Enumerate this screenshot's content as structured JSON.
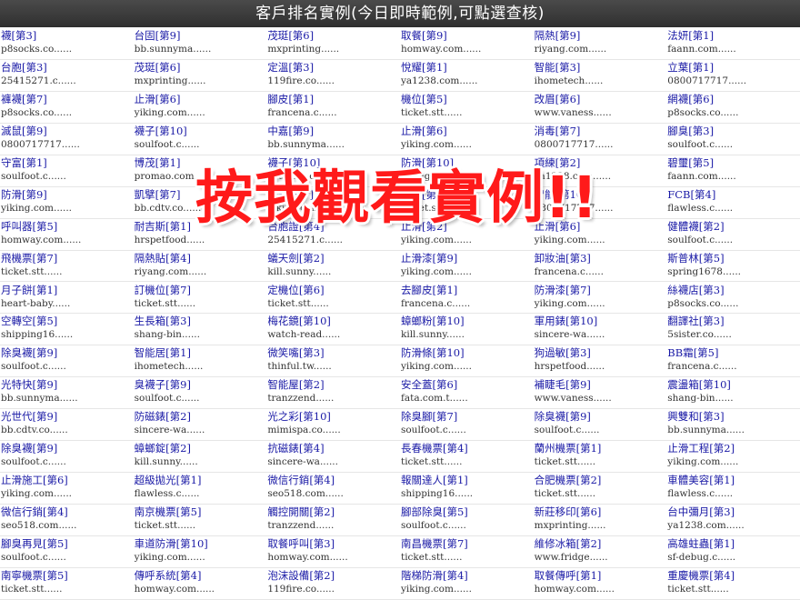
{
  "header": {
    "title": "客戶排名實例(今日即時範例,可點選查核)"
  },
  "overlay": {
    "text": "按我觀看實例!!"
  },
  "rows": [
    [
      {
        "kw": "襪",
        "rank": "[第3]",
        "site": "p8socks.co......"
      },
      {
        "kw": "台固",
        "rank": "[第9]",
        "site": "bb.sunnyma......"
      },
      {
        "kw": "茂珽",
        "rank": "[第6]",
        "site": "mxprinting......"
      },
      {
        "kw": "取餐",
        "rank": "[第9]",
        "site": "homway.com......"
      },
      {
        "kw": "隔熱",
        "rank": "[第9]",
        "site": "riyang.com......"
      },
      {
        "kw": "法妍",
        "rank": "[第1]",
        "site": "faann.com......"
      }
    ],
    [
      {
        "kw": "台胞",
        "rank": "[第3]",
        "site": "25415271.c......"
      },
      {
        "kw": "茂珽",
        "rank": "[第6]",
        "site": "mxprinting......"
      },
      {
        "kw": "定溫",
        "rank": "[第3]",
        "site": "119fire.co......"
      },
      {
        "kw": "悅耀",
        "rank": "[第1]",
        "site": "ya1238.com......"
      },
      {
        "kw": "智能",
        "rank": "[第3]",
        "site": "ihometech......"
      },
      {
        "kw": "立葉",
        "rank": "[第1]",
        "site": "0800717717......"
      }
    ],
    [
      {
        "kw": "褲襪",
        "rank": "[第7]",
        "site": "p8socks.co......"
      },
      {
        "kw": "止滑",
        "rank": "[第6]",
        "site": "yiking.com......"
      },
      {
        "kw": "腳皮",
        "rank": "[第1]",
        "site": "francena.c......"
      },
      {
        "kw": "機位",
        "rank": "[第5]",
        "site": "ticket.stt......"
      },
      {
        "kw": "改眉",
        "rank": "[第6]",
        "site": "www.vaness......"
      },
      {
        "kw": "網襪",
        "rank": "[第6]",
        "site": "p8socks.co......"
      }
    ],
    [
      {
        "kw": "滅鼠",
        "rank": "[第9]",
        "site": "0800717717......"
      },
      {
        "kw": "襪子",
        "rank": "[第10]",
        "site": "soulfoot.c......"
      },
      {
        "kw": "中嘉",
        "rank": "[第9]",
        "site": "bb.sunnyma......"
      },
      {
        "kw": "止滑",
        "rank": "[第6]",
        "site": "yiking.com......"
      },
      {
        "kw": "消毒",
        "rank": "[第7]",
        "site": "0800717717......"
      },
      {
        "kw": "腳臭",
        "rank": "[第3]",
        "site": "soulfoot.c......"
      }
    ],
    [
      {
        "kw": "守富",
        "rank": "[第1]",
        "site": "soulfoot.c......"
      },
      {
        "kw": "博茂",
        "rank": "[第1]",
        "site": "promao.com......"
      },
      {
        "kw": "襪子",
        "rank": "[第10]",
        "site": "soulfoot.c......"
      },
      {
        "kw": "防滑",
        "rank": "[第10]",
        "site": "yiking.com......"
      },
      {
        "kw": "項練",
        "rank": "[第2]",
        "site": "ya1238.com......"
      },
      {
        "kw": "碧璽",
        "rank": "[第5]",
        "site": "faann.com......"
      }
    ],
    [
      {
        "kw": "防滑",
        "rank": "[第9]",
        "site": "yiking.com......"
      },
      {
        "kw": "凱擘",
        "rank": "[第7]",
        "site": "bb.cdtv.co......"
      },
      {
        "kw": "防滑",
        "rank": "[第7]",
        "site": "yiking.com......"
      },
      {
        "kw": "機位",
        "rank": "[第8]",
        "site": "ticket.stt......"
      },
      {
        "kw": "智能",
        "rank": "[第10]",
        "site": "0800717717......"
      },
      {
        "kw": "FCB",
        "rank": "[第4]",
        "site": "flawless.c......"
      }
    ],
    [
      {
        "kw": "呼叫器",
        "rank": "[第5]",
        "site": "homway.com......"
      },
      {
        "kw": "耐吉斯",
        "rank": "[第1]",
        "site": "hrspetfood......"
      },
      {
        "kw": "台胞證",
        "rank": "[第4]",
        "site": "25415271.c......"
      },
      {
        "kw": "止滑",
        "rank": "[第2]",
        "site": "yiking.com......"
      },
      {
        "kw": "止滑",
        "rank": "[第6]",
        "site": "yiking.com......"
      },
      {
        "kw": "健體襪",
        "rank": "[第2]",
        "site": "soulfoot.c......"
      }
    ],
    [
      {
        "kw": "飛機票",
        "rank": "[第7]",
        "site": "ticket.stt......"
      },
      {
        "kw": "隔熱貼",
        "rank": "[第4]",
        "site": "riyang.com......"
      },
      {
        "kw": "蟻天劍",
        "rank": "[第2]",
        "site": "kill.sunny......"
      },
      {
        "kw": "止滑漆",
        "rank": "[第9]",
        "site": "yiking.com......"
      },
      {
        "kw": "卸妝油",
        "rank": "[第3]",
        "site": "francena.c......"
      },
      {
        "kw": "斯普林",
        "rank": "[第5]",
        "site": "spring1678......"
      }
    ],
    [
      {
        "kw": "月子餅",
        "rank": "[第1]",
        "site": "heart-baby......"
      },
      {
        "kw": "訂機位",
        "rank": "[第7]",
        "site": "ticket.stt......"
      },
      {
        "kw": "定機位",
        "rank": "[第6]",
        "site": "ticket.stt......"
      },
      {
        "kw": "去腳皮",
        "rank": "[第1]",
        "site": "francena.c......"
      },
      {
        "kw": "防滑漆",
        "rank": "[第7]",
        "site": "yiking.com......"
      },
      {
        "kw": "絲襪店",
        "rank": "[第3]",
        "site": "p8socks.co......"
      }
    ],
    [
      {
        "kw": "空轉空",
        "rank": "[第5]",
        "site": "shipping16......"
      },
      {
        "kw": "生長箱",
        "rank": "[第3]",
        "site": "shang-bin......"
      },
      {
        "kw": "梅花鏡",
        "rank": "[第10]",
        "site": "watch-read......"
      },
      {
        "kw": "蟑螂粉",
        "rank": "[第10]",
        "site": "kill.sunny......"
      },
      {
        "kw": "軍用錶",
        "rank": "[第10]",
        "site": "sincere-wa......"
      },
      {
        "kw": "翻譯社",
        "rank": "[第3]",
        "site": "5sister.co......"
      }
    ],
    [
      {
        "kw": "除臭襪",
        "rank": "[第9]",
        "site": "soulfoot.c......"
      },
      {
        "kw": "智能居",
        "rank": "[第1]",
        "site": "ihometech......"
      },
      {
        "kw": "微笑嘴",
        "rank": "[第3]",
        "site": "thinful.tw......"
      },
      {
        "kw": "防滑條",
        "rank": "[第10]",
        "site": "yiking.com......"
      },
      {
        "kw": "狗過敏",
        "rank": "[第3]",
        "site": "hrspetfood......"
      },
      {
        "kw": "BB霜",
        "rank": "[第5]",
        "site": "francena.c......"
      }
    ],
    [
      {
        "kw": "光特快",
        "rank": "[第9]",
        "site": "bb.sunnyma......"
      },
      {
        "kw": "臭襪子",
        "rank": "[第9]",
        "site": "soulfoot.c......"
      },
      {
        "kw": "智能屋",
        "rank": "[第2]",
        "site": "tranzzend......"
      },
      {
        "kw": "安全蓋",
        "rank": "[第6]",
        "site": "fata.com.t......"
      },
      {
        "kw": "補睫毛",
        "rank": "[第9]",
        "site": "www.vaness......"
      },
      {
        "kw": "震盪箱",
        "rank": "[第10]",
        "site": "shang-bin......"
      }
    ],
    [
      {
        "kw": "光世代",
        "rank": "[第9]",
        "site": "bb.cdtv.co......"
      },
      {
        "kw": "防磁錶",
        "rank": "[第2]",
        "site": "sincere-wa......"
      },
      {
        "kw": "光之彩",
        "rank": "[第10]",
        "site": "mimispa.co......"
      },
      {
        "kw": "除臭腳",
        "rank": "[第7]",
        "site": "soulfoot.c......"
      },
      {
        "kw": "除臭襪",
        "rank": "[第9]",
        "site": "soulfoot.c......"
      },
      {
        "kw": "興雙和",
        "rank": "[第3]",
        "site": "bb.sunnyma......"
      }
    ],
    [
      {
        "kw": "除臭襪",
        "rank": "[第9]",
        "site": "soulfoot.c......"
      },
      {
        "kw": "蟑螂錠",
        "rank": "[第2]",
        "site": "kill.sunny......"
      },
      {
        "kw": "抗磁錶",
        "rank": "[第4]",
        "site": "sincere-wa......"
      },
      {
        "kw": "長春機票",
        "rank": "[第4]",
        "site": "ticket.stt......"
      },
      {
        "kw": "蘭州機票",
        "rank": "[第1]",
        "site": "ticket.stt......"
      },
      {
        "kw": "止滑工程",
        "rank": "[第2]",
        "site": "yiking.com......"
      }
    ],
    [
      {
        "kw": "止滑施工",
        "rank": "[第6]",
        "site": "yiking.com......"
      },
      {
        "kw": "超級拋光",
        "rank": "[第1]",
        "site": "flawless.c......"
      },
      {
        "kw": "微信行銷",
        "rank": "[第4]",
        "site": "seo518.com......"
      },
      {
        "kw": "報關達人",
        "rank": "[第1]",
        "site": "shipping16......"
      },
      {
        "kw": "合肥機票",
        "rank": "[第2]",
        "site": "ticket.stt......"
      },
      {
        "kw": "車體美容",
        "rank": "[第1]",
        "site": "flawless.c......"
      }
    ],
    [
      {
        "kw": "微信行銷",
        "rank": "[第4]",
        "site": "seo518.com......"
      },
      {
        "kw": "南京機票",
        "rank": "[第5]",
        "site": "ticket.stt......"
      },
      {
        "kw": "觸控開關",
        "rank": "[第2]",
        "site": "tranzzend......"
      },
      {
        "kw": "腳部除臭",
        "rank": "[第5]",
        "site": "soulfoot.c......"
      },
      {
        "kw": "新莊移印",
        "rank": "[第6]",
        "site": "mxprinting......"
      },
      {
        "kw": "台中彌月",
        "rank": "[第3]",
        "site": "ya1238.com......"
      }
    ],
    [
      {
        "kw": "腳臭再見",
        "rank": "[第5]",
        "site": "soulfoot.c......"
      },
      {
        "kw": "車道防滑",
        "rank": "[第10]",
        "site": "yiking.com......"
      },
      {
        "kw": "取餐呼叫",
        "rank": "[第3]",
        "site": "homway.com......"
      },
      {
        "kw": "南昌機票",
        "rank": "[第7]",
        "site": "ticket.stt......"
      },
      {
        "kw": "維修冰箱",
        "rank": "[第2]",
        "site": "www.fridge......"
      },
      {
        "kw": "高雄蛀蟲",
        "rank": "[第1]",
        "site": "sf-debug.c......"
      }
    ],
    [
      {
        "kw": "南寧機票",
        "rank": "[第5]",
        "site": "ticket.stt......"
      },
      {
        "kw": "傳呼系統",
        "rank": "[第4]",
        "site": "homway.com......"
      },
      {
        "kw": "泡沫設備",
        "rank": "[第2]",
        "site": "119fire.co......"
      },
      {
        "kw": "階梯防滑",
        "rank": "[第4]",
        "site": "yiking.com......"
      },
      {
        "kw": "取餐傳呼",
        "rank": "[第1]",
        "site": "homway.com......"
      },
      {
        "kw": "重慶機票",
        "rank": "[第4]",
        "site": "ticket.stt......"
      }
    ]
  ]
}
